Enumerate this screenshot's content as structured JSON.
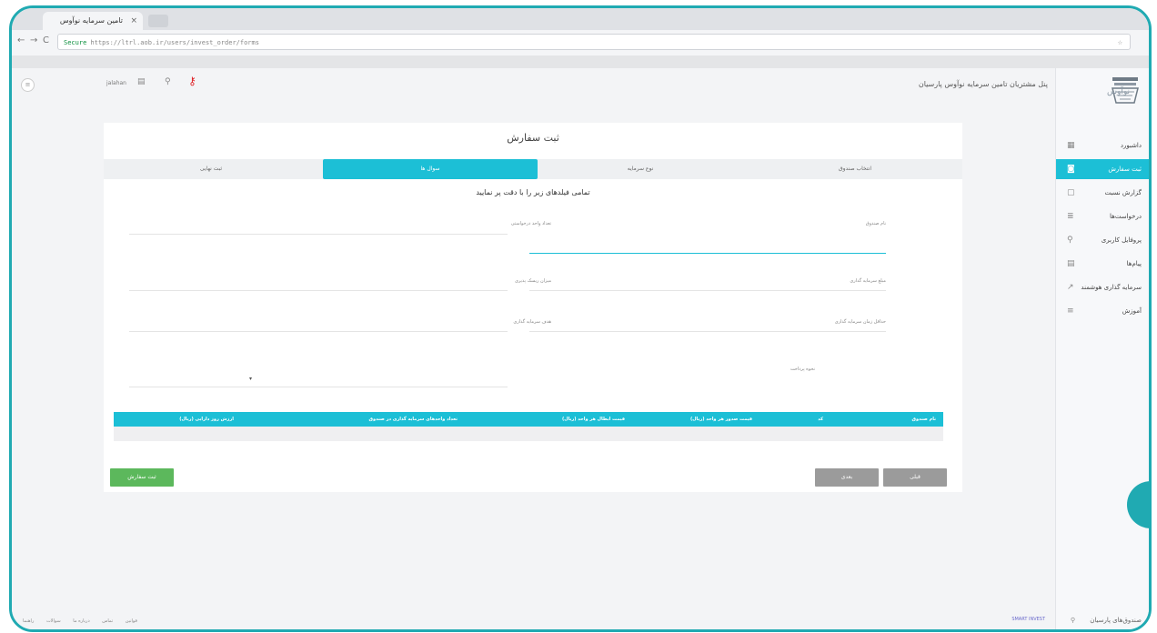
{
  "browser": {
    "tab_title": "تامین سرمایه نوآوس پارسیان",
    "tab_close": "×",
    "url_secure": "Secure",
    "url": "https://ltrl.aob.ir/users/invest_order/forms",
    "star": "☆",
    "back": "←",
    "forward": "→",
    "reload": "C"
  },
  "header": {
    "title": "پنل مشتریان تامین سرمایه نوآوس پارسیان",
    "username": "jalahan",
    "circle_label": "≡"
  },
  "sidebar": {
    "items": [
      {
        "label": "داشبورد",
        "icon": "grid-icon",
        "glyph": "▦"
      },
      {
        "label": "ثبت سفارش",
        "icon": "cart-icon",
        "glyph": "◙"
      },
      {
        "label": "گزارش نسبت",
        "icon": "document-icon",
        "glyph": "▢"
      },
      {
        "label": "درخواست‌ها",
        "icon": "list-icon",
        "glyph": "≣"
      },
      {
        "label": "پروفایل کاربری",
        "icon": "user-icon",
        "glyph": "⚲"
      },
      {
        "label": "پیام‌ها",
        "icon": "mail-icon",
        "glyph": "▤"
      },
      {
        "label": "سرمایه گذاری هوشمند",
        "icon": "chart-icon",
        "glyph": "↗"
      },
      {
        "label": "آموزش",
        "icon": "book-icon",
        "glyph": "≡"
      }
    ],
    "active_index": 1,
    "footer_label": "صندوق‌های پارسیان"
  },
  "form": {
    "title": "ثبت سفارش",
    "steps": [
      "انتخاب صندوق",
      "نوع سرمایه",
      "سوال ها",
      "ثبت نهایی"
    ],
    "active_step": 2,
    "subtitle": "تمامی فیلدهای زیر را با دقت پر نمایید",
    "fields": [
      {
        "label": "نام صندوق"
      },
      {
        "label": "مبلغ سرمایه گذاری"
      },
      {
        "label": "حداقل زمان سرمایه گذاری"
      },
      {
        "label": "تعداد واحد درخواستی"
      },
      {
        "label": "میزان ریسک پذیری"
      },
      {
        "label": "هدف سرمایه گذاری"
      },
      {
        "label": "نحوه پرداخت"
      }
    ]
  },
  "table": {
    "headers": [
      "نام صندوق",
      "کد",
      "قیمت صدور هر واحد (ریال)",
      "قیمت ابطال هر واحد (ریال)",
      "تعداد واحدهای سرمایه گذاری در صندوق",
      "ارزش روز دارایی (ریال)"
    ]
  },
  "buttons": {
    "submit": "ثبت سفارش",
    "next": "بعدی",
    "prev": "قبلی"
  },
  "footer": {
    "links": [
      "قوانین",
      "تماس",
      "درباره ما",
      "سوالات",
      "راهنما"
    ],
    "brand": "SMART INVEST"
  },
  "colors": {
    "accent": "#1cbfd6",
    "frame": "#20aab2",
    "success": "#5cb85c",
    "neutral_button": "#9b9b9b"
  }
}
